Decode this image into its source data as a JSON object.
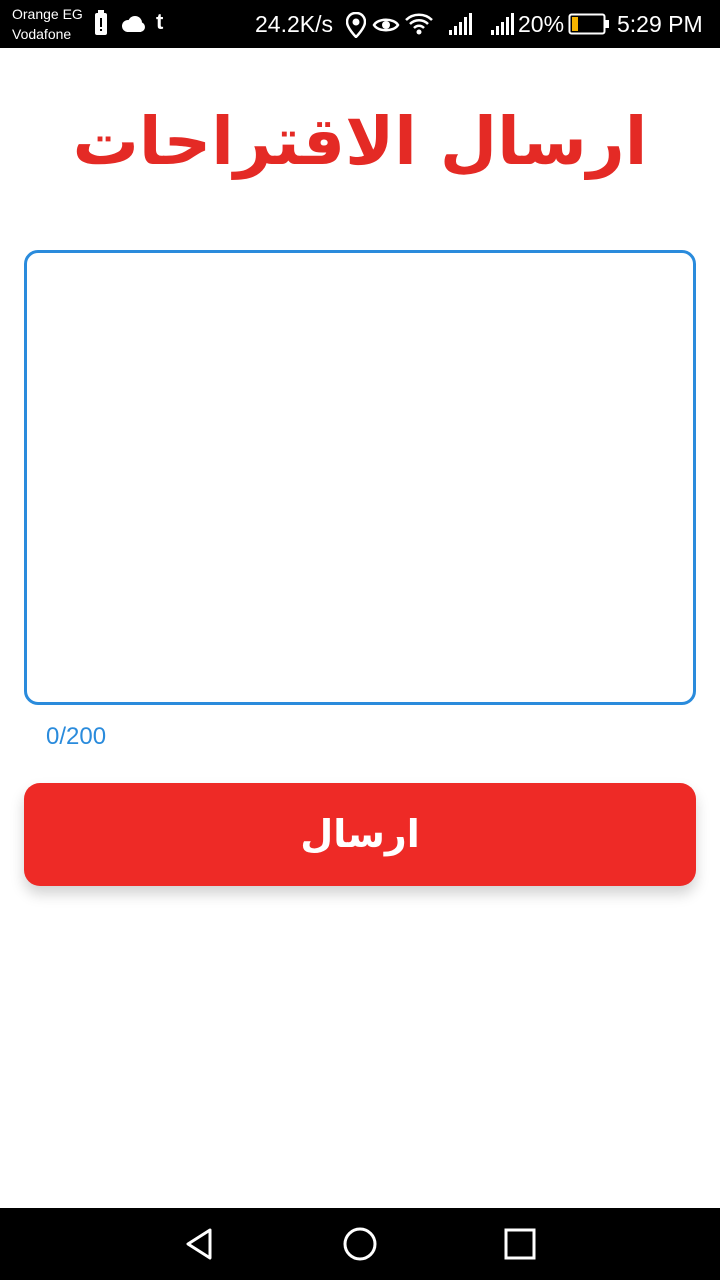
{
  "status_bar": {
    "carrier_1": "Orange EG",
    "carrier_2": "Vodafone",
    "network_speed": "24.2K/s",
    "battery_percent": "20%",
    "time": "5:29 PM",
    "icons": [
      "battery-saver-icon",
      "cloud-icon",
      "tumblr-icon",
      "location-icon",
      "eye-icon",
      "wifi-icon",
      "signal-icon",
      "battery-icon"
    ],
    "battery_level": 0.2,
    "battery_color": "#f5b400"
  },
  "page": {
    "title": "ارسال الاقتراحات",
    "title_color": "#e42a25"
  },
  "suggestion_field": {
    "value": "",
    "counter": "0/200",
    "border_color": "#2a8bdc"
  },
  "submit": {
    "label": "ارسال",
    "color": "#ee2a26"
  },
  "navigation": {
    "buttons": [
      "back-icon",
      "home-icon",
      "recents-icon"
    ]
  }
}
